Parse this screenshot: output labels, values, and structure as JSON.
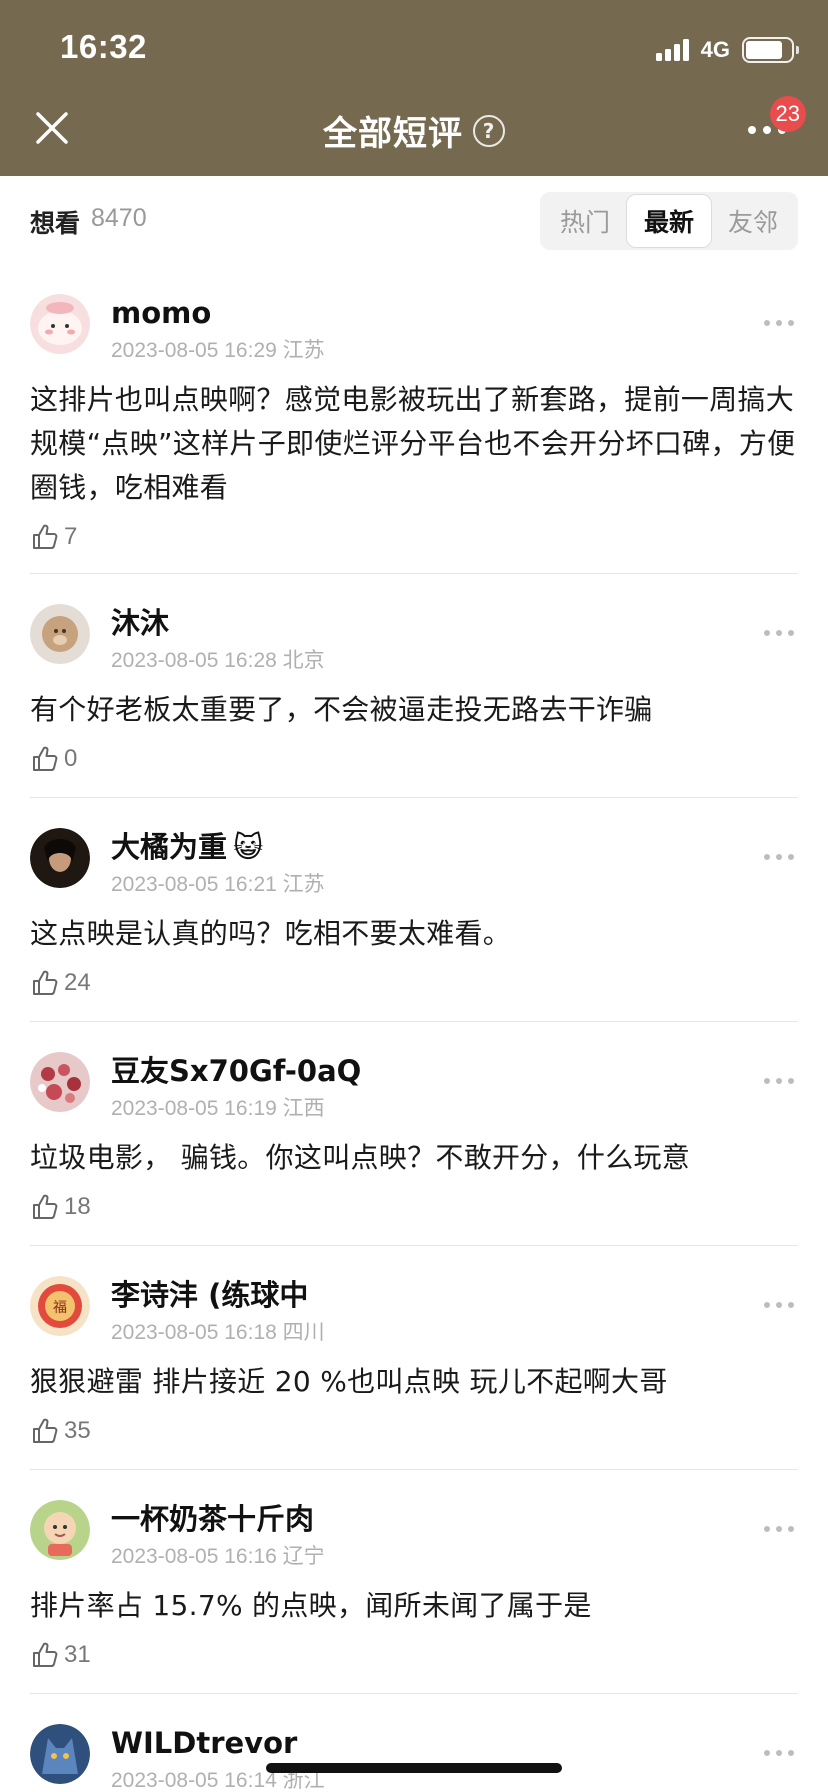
{
  "status_bar": {
    "time": "16:32",
    "network": "4G"
  },
  "nav": {
    "title": "全部短评",
    "help": "?",
    "badge": "23"
  },
  "filter": {
    "want_label": "想看",
    "want_count": "8470",
    "tabs": [
      "热门",
      "最新",
      "友邻"
    ],
    "active_tab": "最新"
  },
  "comments": [
    {
      "name": "momo",
      "time": "2023-08-05 16:29",
      "location": "江苏",
      "text": "这排片也叫点映啊？感觉电影被玩出了新套路，提前一周搞大规模“点映”这样片子即使烂评分平台也不会开分坏口碑，方便圈钱，吃相难看",
      "likes": "7",
      "avatar_color": "#f7d7d9"
    },
    {
      "name": "沐沐",
      "time": "2023-08-05 16:28",
      "location": "北京",
      "text": "有个好老板太重要了，不会被逼走投无路去干诈骗",
      "likes": "0",
      "avatar_color": "#c9b7a4"
    },
    {
      "name": "大橘为重",
      "emoji": "😺",
      "time": "2023-08-05 16:21",
      "location": "江苏",
      "text": "这点映是认真的吗？吃相不要太难看。",
      "likes": "24",
      "avatar_color": "#2b201a"
    },
    {
      "name": "豆友Sx70Gf-0aQ",
      "time": "2023-08-05 16:19",
      "location": "江西",
      "text": "垃圾电影， 骗钱。你这叫点映？不敢开分，什么玩意",
      "likes": "18",
      "avatar_color": "#b9454d"
    },
    {
      "name": "李诗沣 (练球中",
      "time": "2023-08-05 16:18",
      "location": "四川",
      "text": "狠狠避雷 排片接近 20 %也叫点映 玩儿不起啊大哥",
      "likes": "35",
      "avatar_color": "#f0d3b0"
    },
    {
      "name": "一杯奶茶十斤肉",
      "time": "2023-08-05 16:16",
      "location": "辽宁",
      "text": "排片率占 15.7% 的点映，闻所未闻了属于是",
      "likes": "31",
      "avatar_color": "#a9c97b"
    },
    {
      "name": "WILDtrevor",
      "time": "2023-08-05 16:14",
      "location": "浙江",
      "text": "",
      "likes": "",
      "avatar_color": "#3b6aa6"
    }
  ]
}
